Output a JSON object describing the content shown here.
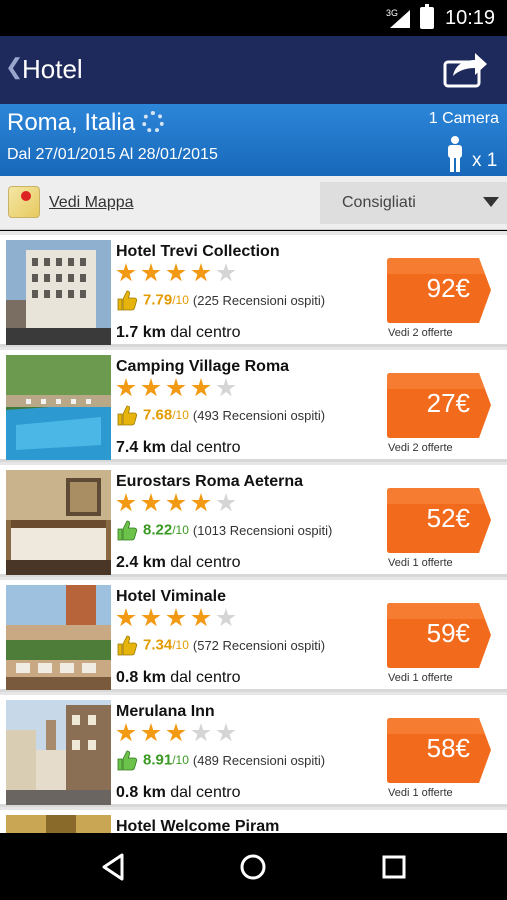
{
  "status": {
    "network": "3G",
    "time": "10:19"
  },
  "appbar": {
    "title": "Hotel",
    "share_icon": "share-icon",
    "back_icon": "back-chevron-icon"
  },
  "search": {
    "city": "Roma, Italia",
    "dates": "Dal 27/01/2015 Al 28/01/2015",
    "rooms": "1 Camera",
    "guests": "x 1"
  },
  "filter": {
    "map_link": "Vedi Mappa",
    "sort_selected": "Consigliati"
  },
  "colors": {
    "appbar": "#1e2a5c",
    "search_bg": "#2177c9",
    "price_orange": "#f26a1c",
    "star_on": "#f39a14",
    "star_off": "#d5d5d5",
    "score_yellow": "#e39b00",
    "score_green": "#3a9a23"
  },
  "hotels": [
    {
      "name": "Hotel Trevi Collection",
      "stars": 4,
      "score": "7.79",
      "outof": "/10",
      "reviews": "(225 Recensioni ospiti)",
      "score_color": "yellow",
      "dist_value": "1.7 km",
      "dist_text": " dal centro",
      "price": "92€",
      "offers": "Vedi 2 offerte"
    },
    {
      "name": "Camping Village Roma",
      "stars": 4,
      "score": "7.68",
      "outof": "/10",
      "reviews": "(493 Recensioni ospiti)",
      "score_color": "yellow",
      "dist_value": "7.4 km",
      "dist_text": " dal centro",
      "price": "27€",
      "offers": "Vedi 2 offerte"
    },
    {
      "name": "Eurostars Roma Aeterna",
      "stars": 4,
      "score": "8.22",
      "outof": "/10",
      "reviews": "(1013 Recensioni ospiti)",
      "score_color": "green",
      "dist_value": "2.4 km",
      "dist_text": " dal centro",
      "price": "52€",
      "offers": "Vedi 1 offerte"
    },
    {
      "name": "Hotel Viminale",
      "stars": 4,
      "score": "7.34",
      "outof": "/10",
      "reviews": "(572 Recensioni ospiti)",
      "score_color": "yellow",
      "dist_value": "0.8 km",
      "dist_text": " dal centro",
      "price": "59€",
      "offers": "Vedi 1 offerte"
    },
    {
      "name": "Merulana Inn",
      "stars": 3,
      "score": "8.91",
      "outof": "/10",
      "reviews": "(489 Recensioni ospiti)",
      "score_color": "green",
      "dist_value": "0.8 km",
      "dist_text": " dal centro",
      "price": "58€",
      "offers": "Vedi 1 offerte"
    },
    {
      "name": "Hotel Welcome Piram",
      "stars": 0,
      "score": "",
      "outof": "",
      "reviews": "",
      "score_color": "yellow",
      "dist_value": "",
      "dist_text": "",
      "price": "",
      "offers": ""
    }
  ],
  "navbar": {
    "back_icon": "nav-back-icon",
    "home_icon": "nav-home-icon",
    "recents_icon": "nav-recents-icon"
  }
}
